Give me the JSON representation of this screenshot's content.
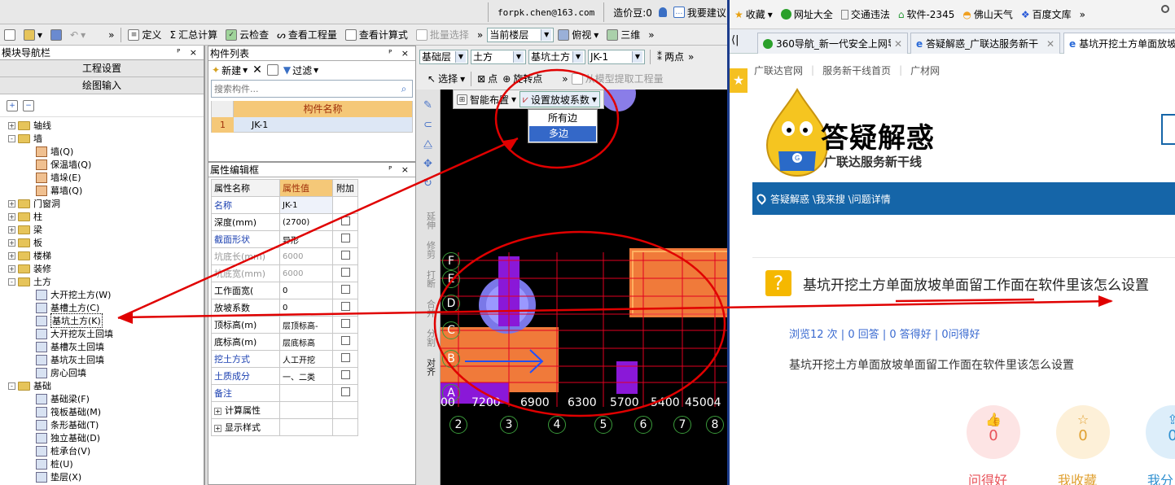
{
  "app": {
    "account": "forpk.chen@163.com",
    "price_beans": "造价豆:0",
    "suggest": "我要建议",
    "toolbar": {
      "define": "定义",
      "sum_calc": "汇总计算",
      "cloud_check": "云检查",
      "view_quantity": "查看工程量",
      "view_formula": "查看计算式",
      "batch_select": "批量选择",
      "floor_select": "当前楼层",
      "view_mode": "俯视",
      "three_d": "三维"
    },
    "nav": {
      "title": "模块导航栏",
      "btn_project": "工程设置",
      "btn_draw": "绘图输入",
      "tree": [
        {
          "label": "轴线",
          "level": 0,
          "type": "folder",
          "exp": "+"
        },
        {
          "label": "墙",
          "level": 0,
          "type": "folder",
          "exp": "-"
        },
        {
          "label": "墙(Q)",
          "level": 1,
          "type": "item"
        },
        {
          "label": "保温墙(Q)",
          "level": 1,
          "type": "item"
        },
        {
          "label": "墙垛(E)",
          "level": 1,
          "type": "item"
        },
        {
          "label": "幕墙(Q)",
          "level": 1,
          "type": "item"
        },
        {
          "label": "门窗洞",
          "level": 0,
          "type": "folder",
          "exp": "+"
        },
        {
          "label": "柱",
          "level": 0,
          "type": "folder",
          "exp": "+"
        },
        {
          "label": "梁",
          "level": 0,
          "type": "folder",
          "exp": "+"
        },
        {
          "label": "板",
          "level": 0,
          "type": "folder",
          "exp": "+"
        },
        {
          "label": "楼梯",
          "level": 0,
          "type": "folder",
          "exp": "+"
        },
        {
          "label": "装修",
          "level": 0,
          "type": "folder",
          "exp": "+"
        },
        {
          "label": "土方",
          "level": 0,
          "type": "folder",
          "exp": "-"
        },
        {
          "label": "大开挖土方(W)",
          "level": 1,
          "type": "item"
        },
        {
          "label": "基槽土方(C)",
          "level": 1,
          "type": "item"
        },
        {
          "label": "基坑土方(K)",
          "level": 1,
          "type": "item",
          "selected": true
        },
        {
          "label": "大开挖灰土回填",
          "level": 1,
          "type": "item"
        },
        {
          "label": "基槽灰土回填",
          "level": 1,
          "type": "item"
        },
        {
          "label": "基坑灰土回填",
          "level": 1,
          "type": "item"
        },
        {
          "label": "房心回填",
          "level": 1,
          "type": "item"
        },
        {
          "label": "基础",
          "level": 0,
          "type": "folder",
          "exp": "-"
        },
        {
          "label": "基础梁(F)",
          "level": 1,
          "type": "item"
        },
        {
          "label": "筏板基础(M)",
          "level": 1,
          "type": "item"
        },
        {
          "label": "条形基础(T)",
          "level": 1,
          "type": "item"
        },
        {
          "label": "独立基础(D)",
          "level": 1,
          "type": "item"
        },
        {
          "label": "桩承台(V)",
          "level": 1,
          "type": "item"
        },
        {
          "label": "桩(U)",
          "level": 1,
          "type": "item"
        },
        {
          "label": "垫层(X)",
          "level": 1,
          "type": "item"
        }
      ]
    },
    "clist": {
      "title": "构件列表",
      "new": "新建",
      "filter": "过滤",
      "search_placeholder": "搜索构件...",
      "col_header": "构件名称",
      "rows": [
        {
          "idx": "1",
          "name": "JK-1"
        }
      ]
    },
    "props": {
      "title": "属性编辑框",
      "headers": [
        "属性名称",
        "属性值",
        "附加"
      ],
      "rows": [
        {
          "name": "名称",
          "value": "JK-1",
          "blue": true,
          "cb": false
        },
        {
          "name": "深度(mm)",
          "value": "(2700)",
          "blue": false,
          "cb": true
        },
        {
          "name": "截面形状",
          "value": "异形",
          "blue": true,
          "cb": true
        },
        {
          "name": "坑底长(mm)",
          "value": "6000",
          "gray": true,
          "cb": true
        },
        {
          "name": "坑底宽(mm)",
          "value": "6000",
          "gray": true,
          "cb": true
        },
        {
          "name": "工作面宽(",
          "value": "0",
          "blue": false,
          "cb": true
        },
        {
          "name": "放坡系数",
          "value": "0",
          "blue": false,
          "cb": true
        },
        {
          "name": "顶标高(m)",
          "value": "层顶标高-",
          "blue": false,
          "cb": true
        },
        {
          "name": "底标高(m)",
          "value": "层底标高",
          "blue": false,
          "cb": true
        },
        {
          "name": "挖土方式",
          "value": "人工开挖",
          "blue": true,
          "cb": true
        },
        {
          "name": "土质成分",
          "value": "一、二类",
          "blue": true,
          "cb": true
        },
        {
          "name": "备注",
          "value": "",
          "blue": true,
          "cb": true
        },
        {
          "name": "计算属性",
          "value": "",
          "expander": true
        },
        {
          "name": "显示样式",
          "value": "",
          "expander": true
        }
      ]
    },
    "draw": {
      "floor": "基础层",
      "category": "土方",
      "type": "基坑土方",
      "component": "JK-1",
      "two_points": "两点",
      "select": "选择",
      "point": "点",
      "rotate_point": "旋转点",
      "extract": "从模型提取工程量",
      "smart_layout": "智能布置",
      "set_slope": "设置放坡系数",
      "menu": [
        "所有边",
        "多边"
      ],
      "vbar": [
        "延伸",
        "修剪",
        "打断",
        "合并",
        "分割",
        "对齐"
      ],
      "axis_rows": [
        "F",
        "E",
        "D",
        "C",
        "B",
        "A"
      ],
      "axis_cols": [
        "2",
        "3",
        "4",
        "5",
        "6",
        "7",
        "8"
      ],
      "dims": [
        "00",
        "7200",
        "6900",
        "6300",
        "5700",
        "5400",
        "45004"
      ]
    }
  },
  "browser": {
    "bookmarks": [
      "收藏",
      "网址大全",
      "交通违法",
      "软件-2345",
      "佛山天气",
      "百度文库"
    ],
    "tabs": [
      "360导航_新一代安全上网导",
      "答疑解惑_广联达服务新干",
      "基坑开挖土方单面放坡"
    ],
    "site_nav": [
      "广联达官网",
      "服务新干线首页",
      "广材网"
    ],
    "logo_title": "答疑解惑",
    "logo_sub": "广联达服务新干线",
    "breadcrumb": "答疑解惑 \\我来搜 \\问题详情",
    "question": "基坑开挖土方单面放坡单面留工作面在软件里该怎么设置",
    "stats": "浏览12 次 | 0 回答 | 0 答得好 | 0问得好",
    "question_body": "基坑开挖土方单面放坡单面留工作面在软件里该怎么设置",
    "actions": [
      {
        "label": "问得好",
        "count": "0",
        "color": "#e8525a",
        "bg": "#fde4e4"
      },
      {
        "label": "我收藏",
        "count": "0",
        "color": "#e0a030",
        "bg": "#fdf0d8"
      },
      {
        "label": "我分",
        "count": "0",
        "color": "#3090d0",
        "bg": "#ddeefa"
      }
    ]
  },
  "colors": {
    "annotation": "#e00000",
    "brand_blue": "#1565a8"
  }
}
